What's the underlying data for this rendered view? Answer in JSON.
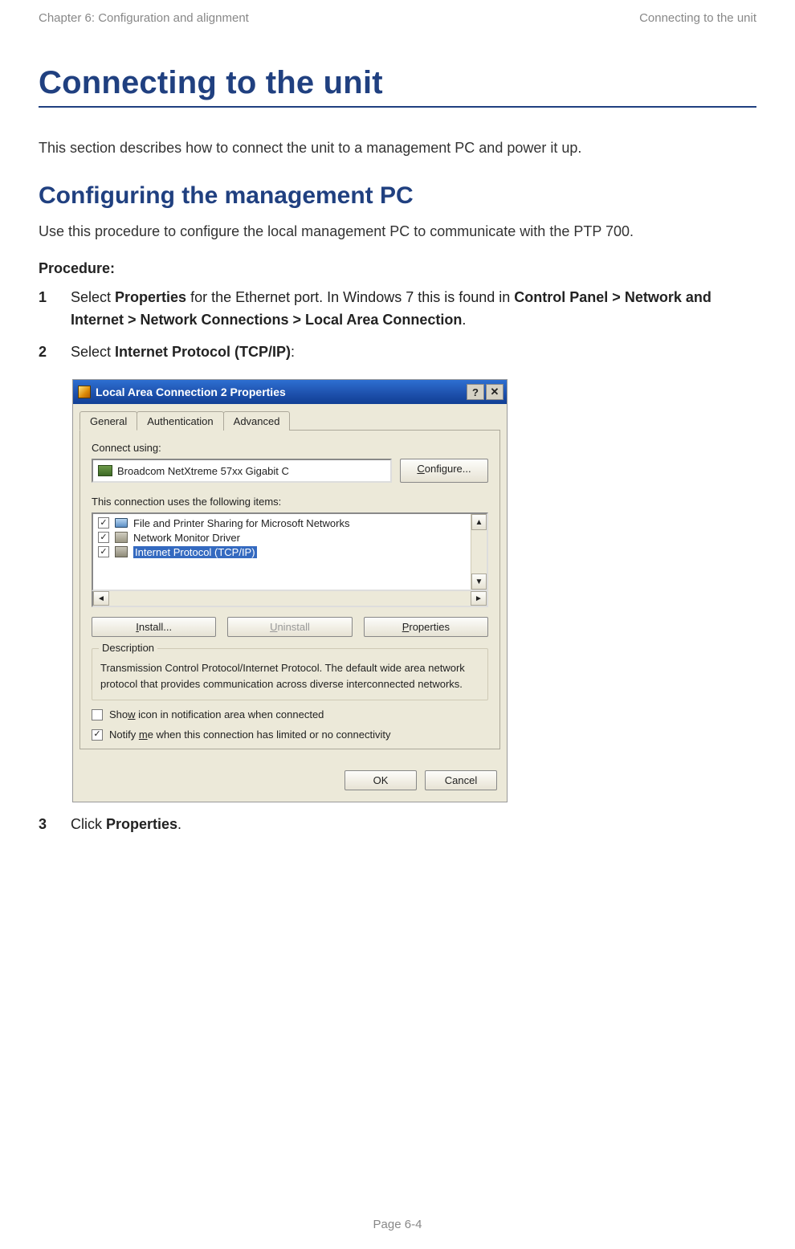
{
  "header": {
    "left": "Chapter 6:  Configuration and alignment",
    "right": "Connecting to the unit"
  },
  "title": "Connecting to the unit",
  "intro": "This section describes how to connect the unit to a management PC and power it up.",
  "subheading": "Configuring the management PC",
  "sub_intro": "Use this procedure to configure the local management PC to communicate with the PTP 700.",
  "procedure_label": "Procedure:",
  "steps": {
    "s1": {
      "num": "1",
      "pre": "Select ",
      "b1": "Properties",
      "mid": " for the Ethernet port. In Windows 7 this is found in ",
      "b2": "Control Panel > Network and Internet > Network Connections > Local Area Connection",
      "post": "."
    },
    "s2": {
      "num": "2",
      "pre": "Select ",
      "b1": "Internet Protocol (TCP/IP)",
      "post": ":"
    },
    "s3": {
      "num": "3",
      "pre": "Click ",
      "b1": "Properties",
      "post": "."
    }
  },
  "dialog": {
    "title": "Local Area Connection 2 Properties",
    "help_glyph": "?",
    "close_glyph": "✕",
    "tabs": {
      "general": "General",
      "authentication": "Authentication",
      "advanced": "Advanced"
    },
    "connect_label": "Connect using:",
    "adapter": "Broadcom NetXtreme 57xx Gigabit C",
    "configure_btn": "Configure...",
    "items_label": "This connection uses the following items:",
    "items": [
      {
        "checked": true,
        "icon": "monitor",
        "text": "File and Printer Sharing for Microsoft Networks",
        "selected": false
      },
      {
        "checked": true,
        "icon": "net1",
        "text": "Network Monitor Driver",
        "selected": false
      },
      {
        "checked": true,
        "icon": "net2",
        "text": "Internet Protocol (TCP/IP)",
        "selected": true
      }
    ],
    "install_btn": "Install...",
    "uninstall_btn": "Uninstall",
    "properties_btn": "Properties",
    "desc_legend": "Description",
    "desc_text": "Transmission Control Protocol/Internet Protocol. The default wide area network protocol that provides communication across diverse interconnected networks.",
    "show_icon": {
      "pre": "Sho",
      "u": "w",
      "post": " icon in notification area when connected",
      "checked": false
    },
    "notify": {
      "pre": "Notify ",
      "u": "m",
      "post": "e when this connection has limited or no connectivity",
      "checked": true
    },
    "install_u": "I",
    "install_rest": "nstall...",
    "uninstall_u": "U",
    "uninstall_rest": "ninstall",
    "properties_u": "P",
    "properties_rest": "roperties",
    "configure_u": "C",
    "configure_rest": "onfigure...",
    "ok_btn": "OK",
    "cancel_btn": "Cancel"
  },
  "footer": "Page 6-4"
}
